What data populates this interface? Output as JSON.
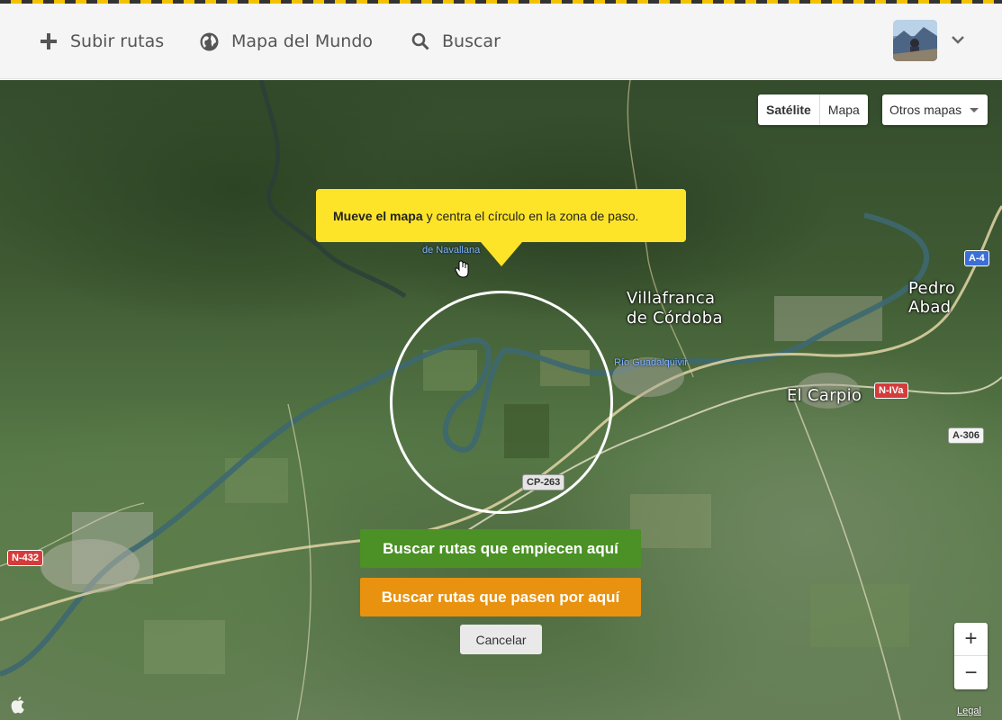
{
  "nav": {
    "upload_label": "Subir rutas",
    "world_map_label": "Mapa del Mundo",
    "search_label": "Buscar"
  },
  "map_controls": {
    "satellite_label": "Satélite",
    "map_label": "Mapa",
    "other_maps_label": "Otros mapas",
    "zoom_in": "+",
    "zoom_out": "−",
    "legal_label": "Legal"
  },
  "tooltip": {
    "bold": "Mueve el mapa",
    "rest": "y centra el círculo en la zona de paso."
  },
  "places": {
    "villafranca_line1": "Villafranca",
    "villafranca_line2": "de Córdoba",
    "el_carpio": "El Carpio",
    "pedro_abad": "Pedro Abad",
    "navallana": "de Navallana",
    "rio": "Río Guadalquivir"
  },
  "roads": {
    "a4": "A-4",
    "n4a": "N-IVa",
    "a306": "A-306",
    "cp263": "CP-263",
    "n432": "N-432"
  },
  "actions": {
    "start_here": "Buscar rutas que empiecen aquí",
    "pass_here": "Buscar rutas que pasen por aquí",
    "cancel": "Cancelar"
  },
  "colors": {
    "start_button": "#4b9126",
    "pass_button": "#e8920f",
    "tooltip": "#fde428"
  }
}
